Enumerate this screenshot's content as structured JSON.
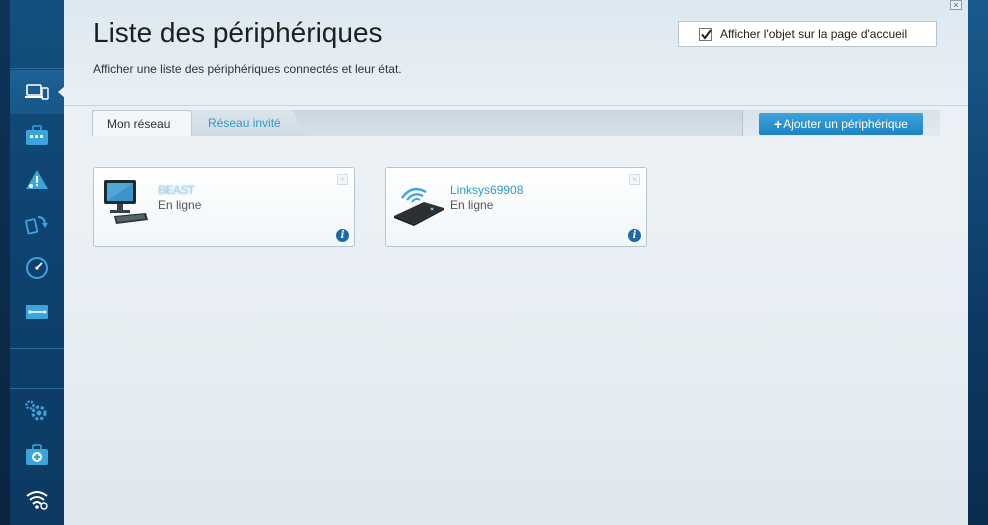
{
  "header": {
    "title": "Liste des périphériques",
    "subtitle": "Afficher une liste des périphériques connectés et leur état.",
    "show_on_home_label": "Afficher l'objet sur la page d'accueil",
    "show_on_home_checked": true
  },
  "tabs": {
    "my_network": "Mon réseau",
    "guest_network": "Réseau invité"
  },
  "toolbar": {
    "add_device_plus": "+",
    "add_device_label": "Ajouter un périphérique"
  },
  "devices": [
    {
      "name": "BEAST",
      "status": "En ligne",
      "icon": "desktop-computer-icon"
    },
    {
      "name": "Linksys69908",
      "status": "En ligne",
      "icon": "wireless-router-icon"
    }
  ],
  "window": {
    "close_glyph": "×"
  },
  "card": {
    "remove_glyph": "×",
    "info_glyph": "i"
  },
  "sidebar": {
    "items": [
      {
        "icon": "device-list-icon",
        "active": true
      },
      {
        "icon": "calendar-toolbox-icon"
      },
      {
        "icon": "network-warning-icon"
      },
      {
        "icon": "mobile-transfer-icon"
      },
      {
        "icon": "speed-gauge-icon"
      },
      {
        "icon": "usb-storage-icon"
      },
      {
        "icon": "gears-settings-icon"
      },
      {
        "icon": "troubleshooting-kit-icon"
      },
      {
        "icon": "wifi-settings-icon"
      }
    ]
  },
  "colors": {
    "accent_blue": "#2e9ac9",
    "button_blue": "#2a92d0",
    "sidebar_blue": "#124b79"
  }
}
